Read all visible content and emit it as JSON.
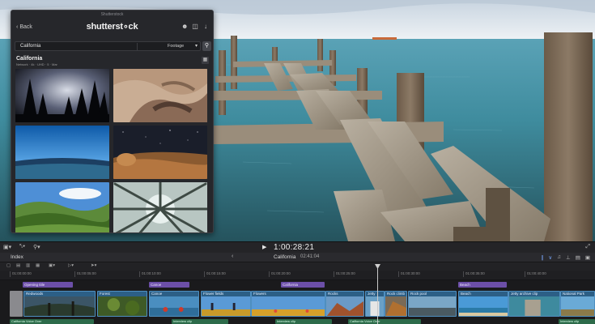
{
  "panel": {
    "window_title": "Shutterstock",
    "back_label": "Back",
    "logo": "shutterst∘ck",
    "search_query": "California",
    "filter_label": "Footage",
    "result_title": "California",
    "result_info": "Network · 4k · UHD · 5 · Mar",
    "thumbnails": [
      "night-trees",
      "sand-dunes",
      "blue-sky-horizon",
      "starry-desert",
      "green-hills",
      "tree-canopy"
    ]
  },
  "transport": {
    "timecode": "1:00:28:21"
  },
  "timeline_header": {
    "index_label": "Index",
    "project_name": "California",
    "duration": "02:41:04"
  },
  "ruler": {
    "ticks": [
      "01:00:00:00",
      "01:00:05:00",
      "01:00:10:00",
      "01:00:15:00",
      "01:00:20:00",
      "01:00:25:00",
      "01:00:30:00",
      "01:00:35:00",
      "01:00:40:00"
    ]
  },
  "tracks": {
    "titles": [
      {
        "label": "Opening title"
      },
      {
        "label": "Canoe"
      },
      {
        "label": "California"
      },
      {
        "label": "Beach"
      }
    ],
    "video": [
      {
        "label": "Redwoods"
      },
      {
        "label": "Forest"
      },
      {
        "label": "Canoe"
      },
      {
        "label": "Flower fields"
      },
      {
        "label": "Flowers"
      },
      {
        "label": "Rocks"
      },
      {
        "label": "Jetty"
      },
      {
        "label": "Rock climb"
      },
      {
        "label": "Rock pool"
      },
      {
        "label": "Beach"
      },
      {
        "label": "Jetty archive clip"
      },
      {
        "label": "National Park"
      }
    ],
    "audio": [
      {
        "label": "California Voice Over"
      },
      {
        "label": "Interview clip"
      },
      {
        "label": "Interview clip"
      },
      {
        "label": "California Voice Over"
      },
      {
        "label": "Interview clip"
      }
    ]
  }
}
